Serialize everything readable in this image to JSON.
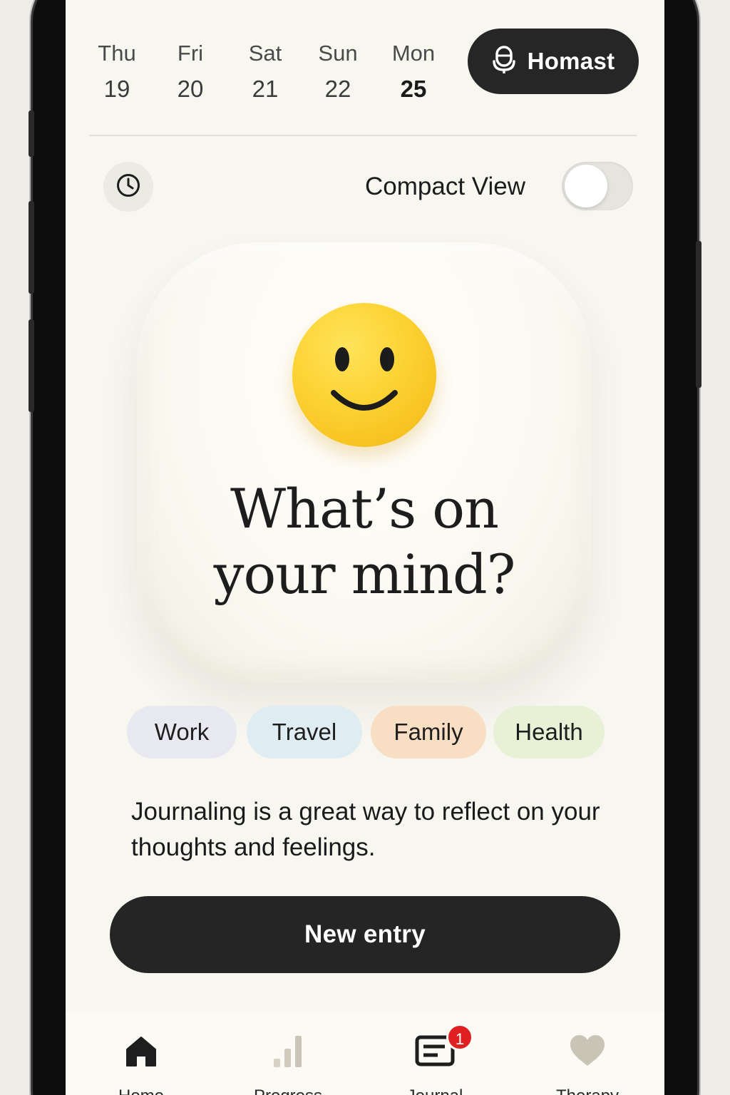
{
  "dates": [
    {
      "day": "Thu",
      "num": "19",
      "active": false
    },
    {
      "day": "Fri",
      "num": "20",
      "active": false
    },
    {
      "day": "Sat",
      "num": "21",
      "active": false
    },
    {
      "day": "Sun",
      "num": "22",
      "active": false
    },
    {
      "day": "Mon",
      "num": "25",
      "active": true
    }
  ],
  "header": {
    "homast_label": "Homast"
  },
  "settings": {
    "compact_view_label": "Compact View",
    "compact_view_on": false
  },
  "hero": {
    "title_line1": "What’s on",
    "title_line2": "your mind?"
  },
  "tags": [
    {
      "label": "Work",
      "color": "#e8e8f0"
    },
    {
      "label": "Travel",
      "color": "#dfedf3"
    },
    {
      "label": "Family",
      "color": "#f8dfc4"
    },
    {
      "label": "Health",
      "color": "#e8f1d6"
    }
  ],
  "description": "Journaling is a great way to reflect on your thoughts and feelings.",
  "cta": {
    "new_entry_label": "New entry"
  },
  "nav": {
    "items": [
      {
        "label": "Home",
        "icon": "home-icon"
      },
      {
        "label": "Progress",
        "icon": "bar-chart-icon"
      },
      {
        "label": "Journal",
        "icon": "journal-icon",
        "badge": "1"
      },
      {
        "label": "Therapy",
        "icon": "heart-icon"
      }
    ]
  },
  "colors": {
    "background": "#f7f6ef",
    "dark": "#252525",
    "smiley": "#fcd232",
    "badge": "#e02020"
  }
}
